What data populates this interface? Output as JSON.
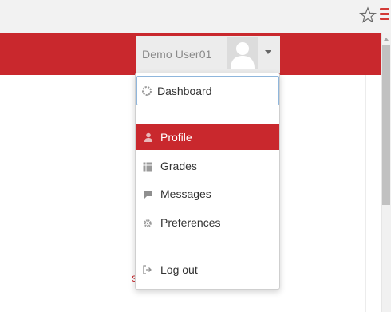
{
  "browser": {
    "bookmark_icon": "star-outline-icon",
    "menu_icon": "hamburger-menu-icon",
    "accent": "#d33a36"
  },
  "navbar": {
    "color": "#c9282d",
    "user_name": "Demo User01",
    "avatar_icon": "default-avatar-icon",
    "caret_icon": "caret-down-icon"
  },
  "dropdown": {
    "items": [
      {
        "label": "Dashboard",
        "icon": "dashboard-icon"
      },
      {
        "label": "Profile",
        "icon": "user-icon",
        "active": true
      },
      {
        "label": "Grades",
        "icon": "grades-table-icon"
      },
      {
        "label": "Messages",
        "icon": "speech-bubble-icon"
      },
      {
        "label": "Preferences",
        "icon": "cog-icon"
      },
      {
        "label": "Log out",
        "icon": "sign-out-icon"
      }
    ]
  },
  "page": {
    "partial_text": "s"
  }
}
